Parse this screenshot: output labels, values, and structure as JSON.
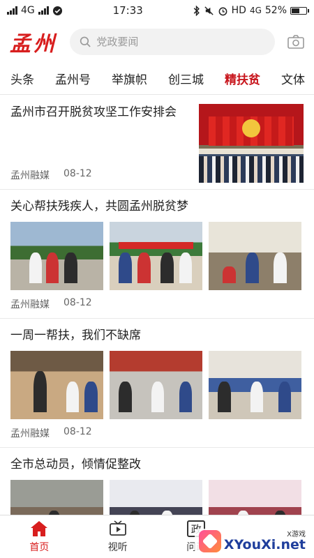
{
  "status_bar": {
    "network": "4G",
    "time": "17:33",
    "hd_label": "HD",
    "net_right": "4G",
    "battery": "52%"
  },
  "header": {
    "logo": "孟州",
    "search_placeholder": "党政要闻"
  },
  "tabs": [
    "头条",
    "孟州号",
    "举旗帜",
    "创三城",
    "精扶贫",
    "文体"
  ],
  "active_tab": "精扶贫",
  "articles": [
    {
      "title": "孟州市召开脱贫攻坚工作安排会",
      "source": "孟州融媒",
      "date": "08-12"
    },
    {
      "title": "关心帮扶残疾人，共圆孟州脱贫梦",
      "source": "孟州融媒",
      "date": "08-12"
    },
    {
      "title": "一周一帮扶，我们不缺席",
      "source": "孟州融媒",
      "date": "08-12"
    },
    {
      "title": "全市总动员，倾情促整改",
      "source": "",
      "date": ""
    }
  ],
  "bottom_nav": [
    {
      "label": "首页",
      "icon": "home-icon",
      "active": true
    },
    {
      "label": "视听",
      "icon": "tv-icon",
      "active": false
    },
    {
      "label": "问政",
      "icon": "zheng-icon",
      "active": false
    },
    {
      "label": "",
      "icon": "",
      "active": false
    }
  ],
  "watermark": {
    "top": "X游戏",
    "main": "XYouXi.net"
  },
  "colors": {
    "accent": "#d81e1e",
    "text": "#222222",
    "meta": "#666666"
  }
}
